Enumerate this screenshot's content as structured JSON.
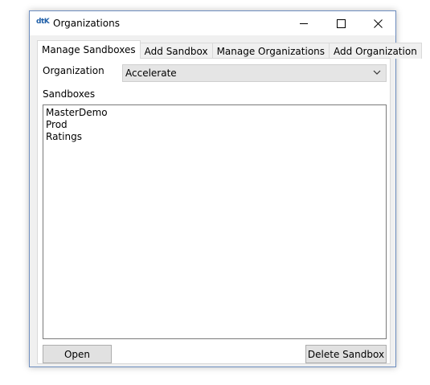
{
  "window": {
    "title": "Organizations",
    "icon_text": "dtK",
    "icon": "app-logo-icon"
  },
  "controls": {
    "minimize": "minimize-icon",
    "maximize": "maximize-icon",
    "close": "close-icon"
  },
  "tabs": [
    {
      "label": "Manage Sandboxes",
      "active": true
    },
    {
      "label": "Add Sandbox",
      "active": false
    },
    {
      "label": "Manage Organizations",
      "active": false
    },
    {
      "label": "Add Organization",
      "active": false
    }
  ],
  "manage_sandboxes": {
    "organization_label": "Organization",
    "organization_value": "Accelerate",
    "sandboxes_label": "Sandboxes",
    "sandboxes": [
      "MasterDemo",
      "Prod",
      "Ratings"
    ],
    "open_button": "Open",
    "delete_button": "Delete Sandbox"
  },
  "colors": {
    "window_border": "#6d8dbf",
    "icon_accent": "#1f5fa8",
    "panel_background": "#ffffff",
    "chrome_background": "#f0f0f0"
  }
}
